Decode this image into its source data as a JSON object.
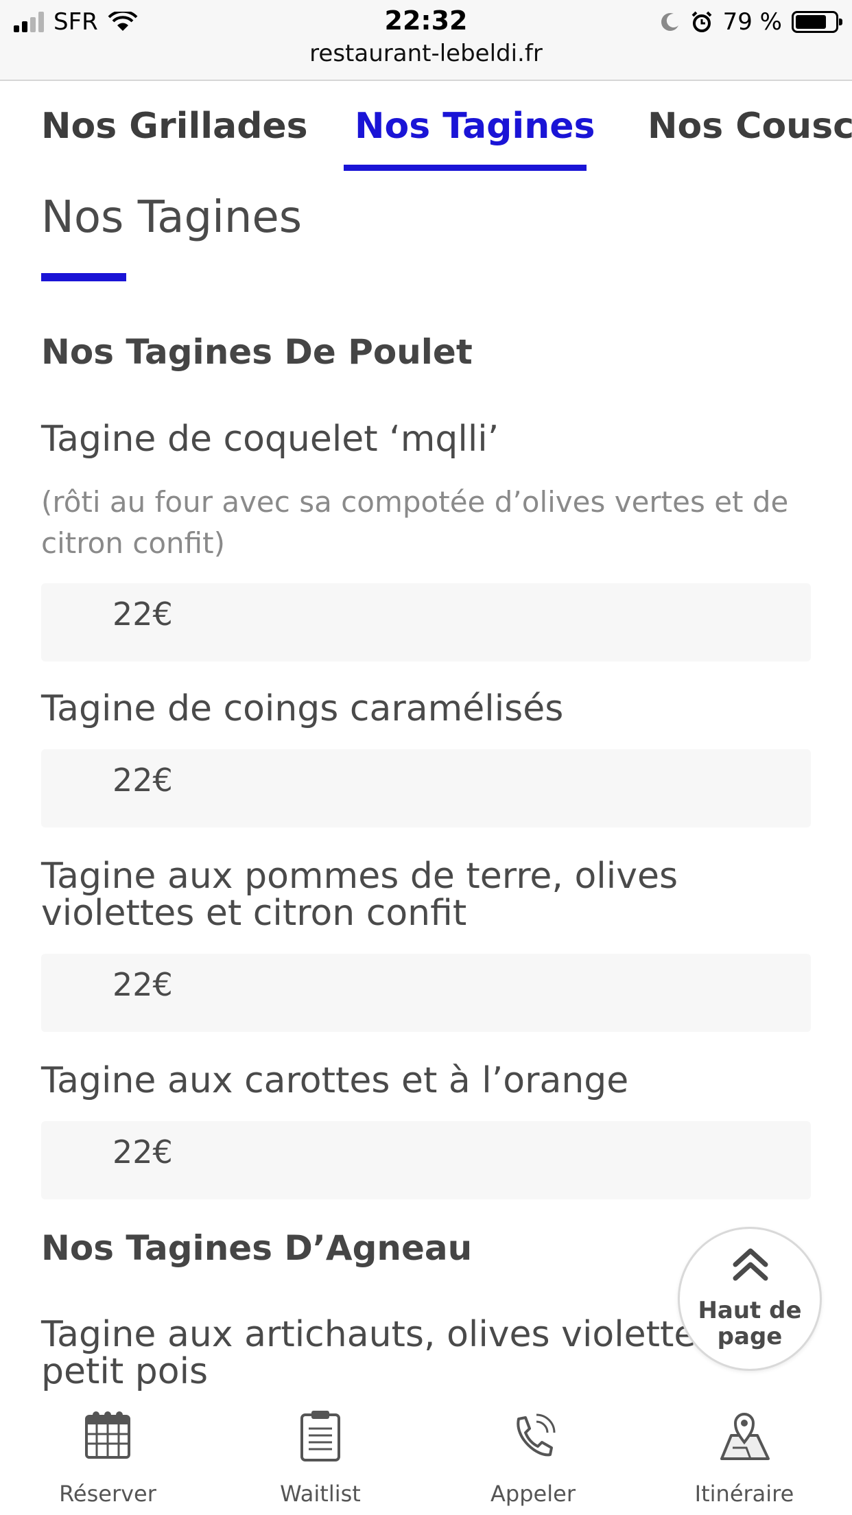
{
  "status_bar": {
    "carrier": "SFR",
    "time": "22:32",
    "url": "restaurant-lebeldi.fr",
    "battery": "79 %",
    "battery_level": 0.79
  },
  "tabs": [
    {
      "label": "Nos Grillades",
      "active": false
    },
    {
      "label": "Nos Tagines",
      "active": true
    },
    {
      "label": "Nos Couscous",
      "active": false
    }
  ],
  "page_title": "Nos Tagines",
  "sections": [
    {
      "title": "Nos Tagines De Poulet",
      "dishes": [
        {
          "name": "Tagine de coquelet ‘mqlli’",
          "description": "(rôti au four avec sa compotée d’olives vertes et de citron confit)",
          "price": "22€"
        },
        {
          "name": "Tagine de coings caramélisés",
          "price": "22€"
        },
        {
          "name": "Tagine aux pommes de terre, olives violettes et citron confit",
          "price": "22€"
        },
        {
          "name": "Tagine aux carottes et à l’orange",
          "price": "22€"
        }
      ]
    },
    {
      "title": "Nos Tagines D’Agneau",
      "dishes": [
        {
          "name": "Tagine aux artichauts, olives violettes et petit pois"
        }
      ]
    }
  ],
  "back_to_top": {
    "label": "Haut de page",
    "icon": "double-chevron-up-icon"
  },
  "bottom_nav": [
    {
      "label": "Réserver",
      "icon": "calendar-icon"
    },
    {
      "label": "Waitlist",
      "icon": "clipboard-icon"
    },
    {
      "label": "Appeler",
      "icon": "phone-icon"
    },
    {
      "label": "Itinéraire",
      "icon": "map-pin-icon"
    }
  ]
}
